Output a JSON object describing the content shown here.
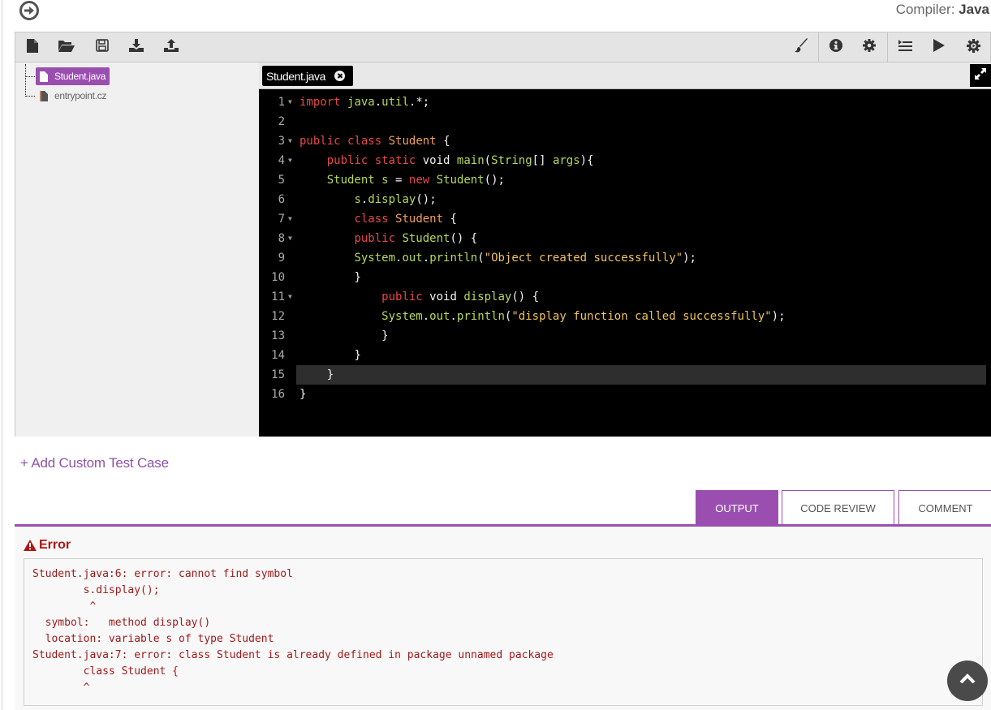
{
  "header": {
    "nav_icon": "arrow-circle-right-icon",
    "compiler_label": "Compiler:",
    "compiler_value": "Java"
  },
  "toolbar": {
    "left_icons": [
      "new-file-icon",
      "open-folder-icon",
      "save-icon",
      "download-icon",
      "upload-icon"
    ],
    "right_icons": [
      "brush-icon",
      "info-icon",
      "settings-icon",
      "indent-icon",
      "run-icon",
      "debug-gear-icon"
    ]
  },
  "file_tree": {
    "items": [
      {
        "name": "Student.java",
        "active": true
      },
      {
        "name": "entrypoint.cz",
        "active": false
      }
    ]
  },
  "editor": {
    "open_tab": "Student.java",
    "active_line": 15,
    "lines": [
      {
        "n": "1",
        "fold": true,
        "code": "import java.util.*;"
      },
      {
        "n": "2",
        "fold": false,
        "code": ""
      },
      {
        "n": "3",
        "fold": true,
        "code": "public class Student {"
      },
      {
        "n": "4",
        "fold": true,
        "code": "    public static void main(String[] args){"
      },
      {
        "n": "5",
        "fold": false,
        "code": "    Student s = new Student();"
      },
      {
        "n": "6",
        "fold": false,
        "code": "        s.display();"
      },
      {
        "n": "7",
        "fold": true,
        "code": "        class Student {"
      },
      {
        "n": "8",
        "fold": true,
        "code": "        public Student() {"
      },
      {
        "n": "9",
        "fold": false,
        "code": "        System.out.println(\"Object created successfully\");"
      },
      {
        "n": "10",
        "fold": false,
        "code": "        }"
      },
      {
        "n": "11",
        "fold": true,
        "code": "            public void display() {"
      },
      {
        "n": "12",
        "fold": false,
        "code": "            System.out.println(\"display function called successfully\");"
      },
      {
        "n": "13",
        "fold": false,
        "code": "            }"
      },
      {
        "n": "14",
        "fold": false,
        "code": "        }"
      },
      {
        "n": "15",
        "fold": false,
        "code": "    }"
      },
      {
        "n": "16",
        "fold": false,
        "code": "}"
      }
    ]
  },
  "add_test_case": "+ Add Custom Test Case",
  "output_tabs": [
    {
      "label": "OUTPUT",
      "active": true
    },
    {
      "label": "CODE REVIEW",
      "active": false
    },
    {
      "label": "COMMENT",
      "active": false
    }
  ],
  "output": {
    "status_title": "Error",
    "log": "Student.java:6: error: cannot find symbol\n        s.display();\n         ^\n  symbol:   method display()\n  location: variable s of type Student\nStudent.java:7: error: class Student is already defined in package unnamed package\n        class Student {\n        ^"
  },
  "colors": {
    "accent": "#9a4fb0",
    "error": "#b01414",
    "editor_bg": "#000000"
  }
}
